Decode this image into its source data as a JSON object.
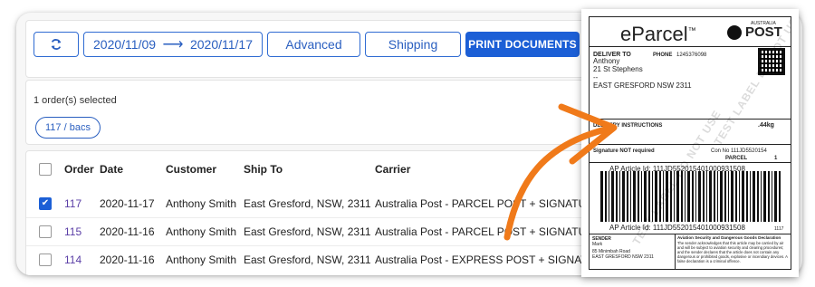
{
  "toolbar": {
    "refresh_icon": "refresh-icon",
    "date_from": "2020/11/09",
    "date_arrow": "⟶",
    "date_to": "2020/11/17",
    "advanced": "Advanced",
    "shipping": "Shipping",
    "print": "PRINT DOCUMENTS"
  },
  "selection": {
    "count_text": "1 order(s) selected",
    "chip": "117 / bacs"
  },
  "table": {
    "headers": [
      "Order",
      "Date",
      "Customer",
      "Ship To",
      "Carrier"
    ],
    "rows": [
      {
        "checked": true,
        "order": "117",
        "date": "2020-11-17",
        "customer": "Anthony Smith",
        "ship_to": "East Gresford, NSW, 2311",
        "carrier": "Australia Post - PARCEL POST + SIGNATURE"
      },
      {
        "checked": false,
        "order": "115",
        "date": "2020-11-16",
        "customer": "Anthony Smith",
        "ship_to": "East Gresford, NSW, 2311",
        "carrier": "Australia Post - PARCEL POST + SIGNATURE"
      },
      {
        "checked": false,
        "order": "114",
        "date": "2020-11-16",
        "customer": "Anthony Smith",
        "ship_to": "East Gresford, NSW, 2311",
        "carrier": "Australia Post - EXPRESS POST + SIGNATURE"
      }
    ]
  },
  "label": {
    "brand": "eParcel",
    "brand_tm": "™",
    "carrier_brand": "POST",
    "carrier_small": "AUSTRALIA",
    "deliver_to": "DELIVER TO",
    "phone_label": "PHONE",
    "phone": "1245376098",
    "name": "Anthony",
    "street": "21 St Stephens",
    "line3": "--",
    "suburb": "EAST GRESFORD NSW 2311",
    "delivery_instructions": "DELIVERY INSTRUCTIONS",
    "weight": ".44kg",
    "signature": "Signature NOT required",
    "con_no": "Con No 111JD5520154",
    "parcel_label": "PARCEL",
    "parcel_count": "1",
    "article_top": "AP Article Id: 111JD5520154010009315​08",
    "article_bottom": "AP Article Id: 111JD5520154010009315​08",
    "barcode_suffix": "1117",
    "sender_label": "SENDER",
    "sender_name": "Mark",
    "sender_street": "85 Minimbah Road",
    "sender_suburb": "EAST GRESFORD NSW 2311",
    "aviation_title": "Aviation Security and Dangerous Goods Declaration",
    "aviation_text": "The sender acknowledges that this article may be carried by air and will be subject to aviation security and clearing procedures; and the sender declares that the article does not contain any dangerous or prohibited goods, explosive or incendiary devices. A false declaration is a criminal offence.",
    "watermark": "TEST LABEL DO NOT USE"
  },
  "colors": {
    "accent": "#1c5fd6",
    "link": "#5a3ea6",
    "arrow": "#f07a1a"
  }
}
